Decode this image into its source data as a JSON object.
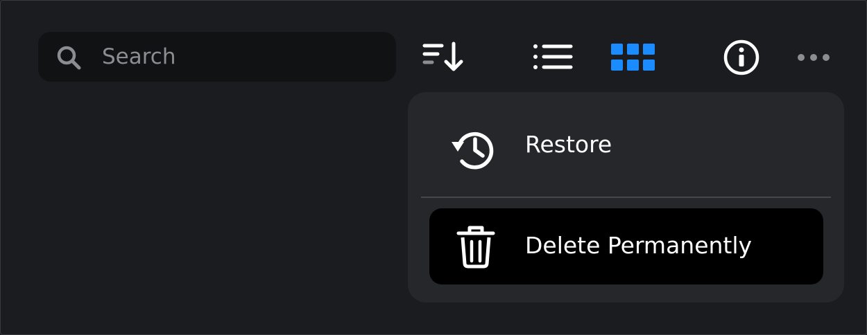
{
  "search": {
    "placeholder": "Search",
    "icon": "search-icon"
  },
  "toolbar": {
    "sort_icon": "sort-descending-icon",
    "list_view_icon": "list-view-icon",
    "grid_view_icon": "grid-view-icon",
    "grid_view_selected": true,
    "info_icon": "info-icon",
    "more_icon": "more-options-icon"
  },
  "context_menu": {
    "items": [
      {
        "label": "Restore",
        "icon": "restore-history-icon"
      },
      {
        "label": "Delete Permanently",
        "icon": "trash-icon"
      }
    ]
  },
  "colors": {
    "background": "#1b1c1f",
    "search_background": "#111214",
    "menu_background": "#25272b",
    "highlight_background": "#000000",
    "accent": "#1a8cff",
    "icon": "#ffffff",
    "muted_icon": "#8c8d90"
  }
}
